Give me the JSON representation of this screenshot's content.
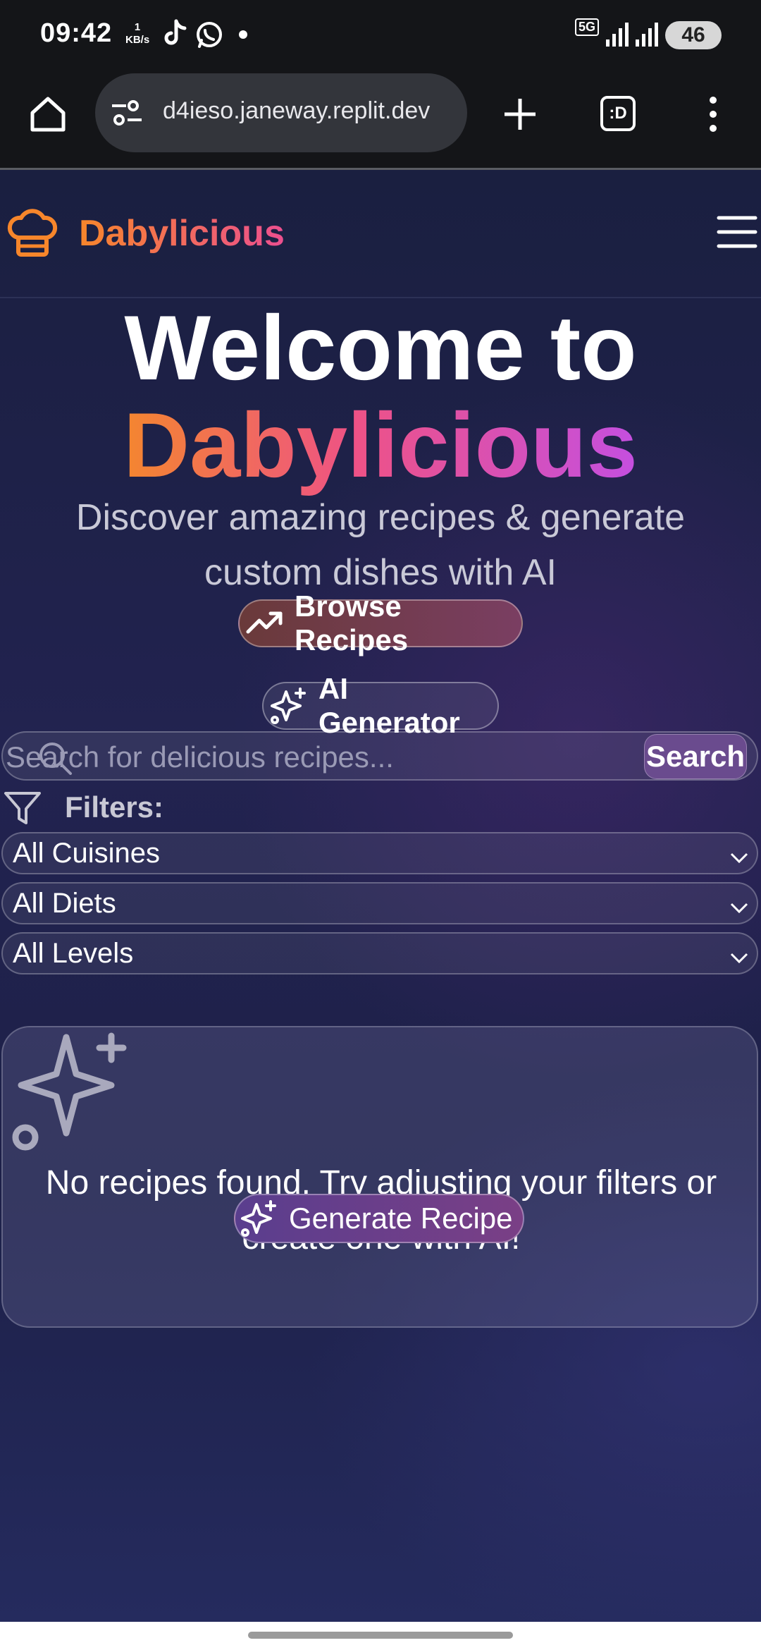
{
  "status_bar": {
    "time": "09:42",
    "speed_value": "1",
    "speed_unit": "KB/s",
    "network": "5G",
    "battery": "46"
  },
  "browser": {
    "url": "d4ieso.janeway.replit.dev",
    "tab_switcher_label": ":D"
  },
  "header": {
    "brand": "Dabylicious",
    "logo_icon": "chef-hat-icon",
    "menu_icon": "hamburger-menu-icon"
  },
  "hero": {
    "line1": "Welcome to",
    "line2": "Dabylicious",
    "subtitle": "Discover amazing recipes & generate custom dishes with AI",
    "browse_label": "Browse Recipes",
    "ai_label": "AI Generator"
  },
  "search": {
    "placeholder": "Search for delicious recipes...",
    "button_label": "Search"
  },
  "filters": {
    "label": "Filters:",
    "cuisine": "All Cuisines",
    "diet": "All Diets",
    "level": "All Levels"
  },
  "empty_state": {
    "message": "No recipes found. Try adjusting your filters or create one with AI!",
    "button_label": "Generate Recipe"
  },
  "colors": {
    "brand_orange": "#f7862b",
    "brand_pink": "#ec4f8f",
    "brand_purple": "#c44fe0",
    "page_bg": "#1d2048"
  }
}
